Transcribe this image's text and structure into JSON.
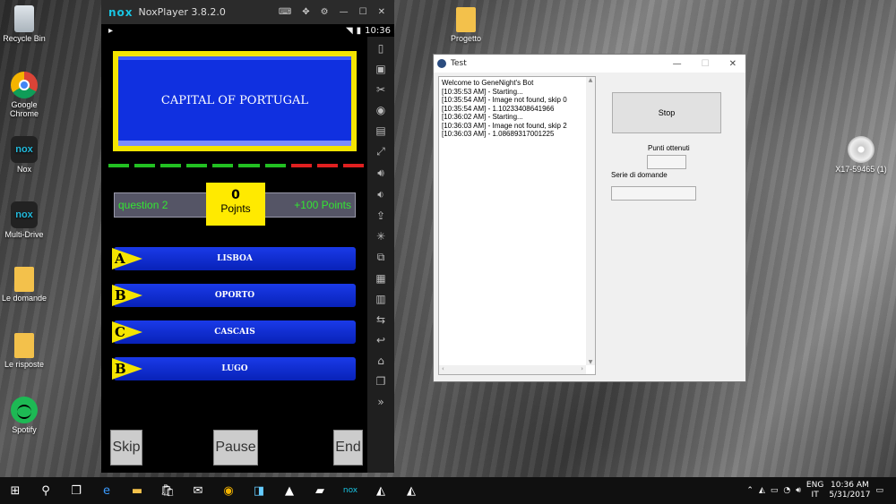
{
  "desktop": {
    "icons": [
      {
        "label": "Recycle Bin"
      },
      {
        "label": "Google Chrome"
      },
      {
        "label": "Nox"
      },
      {
        "label": "Multi-Drive"
      },
      {
        "label": "Le domande"
      },
      {
        "label": "Le risposte"
      },
      {
        "label": "Spotify"
      },
      {
        "label": "Progetto"
      },
      {
        "label": "X17-59465 (1)"
      }
    ]
  },
  "nox": {
    "logo": "nox",
    "title": "NoxPlayer 3.8.2.0",
    "status_time": "10:36",
    "game": {
      "question": "CAPITAL OF PORTUGAL",
      "question_number": "question 2",
      "score_value": "0",
      "score_label": "Pojnts",
      "bonus": "+100 Points",
      "timer": {
        "green": 7,
        "red": 3
      },
      "answers": [
        {
          "letter": "A",
          "text": "LISBOA"
        },
        {
          "letter": "B",
          "text": "OPORTO"
        },
        {
          "letter": "C",
          "text": "CASCAIS"
        },
        {
          "letter": "B",
          "text": "LUGO"
        }
      ],
      "buttons": {
        "skip": "Skip",
        "pause": "Pause",
        "end": "End"
      }
    }
  },
  "test_window": {
    "title": "Test",
    "log": [
      "Welcome to GeneNight's Bot",
      "[10:35:53 AM] - Starting...",
      "[10:35:54 AM] - Image not found, skip 0",
      "[10:35:54 AM] - 1.10233408641966",
      "[10:36:02 AM] - Starting...",
      "[10:36:03 AM] - Image not found, skip 2",
      "[10:36:03 AM] - 1.08689317001225"
    ],
    "stop_label": "Stop",
    "points_label": "Punti ottenuti",
    "series_label": "Serie di domande"
  },
  "taskbar": {
    "lang": "ENG",
    "region": "IT",
    "time": "10:36 AM",
    "date": "5/31/2017"
  },
  "colors": {
    "accent_blue": "#1030e0",
    "yellow": "#f4e400",
    "green": "#33e633",
    "timer_green": "#22c022",
    "timer_red": "#e02020"
  }
}
